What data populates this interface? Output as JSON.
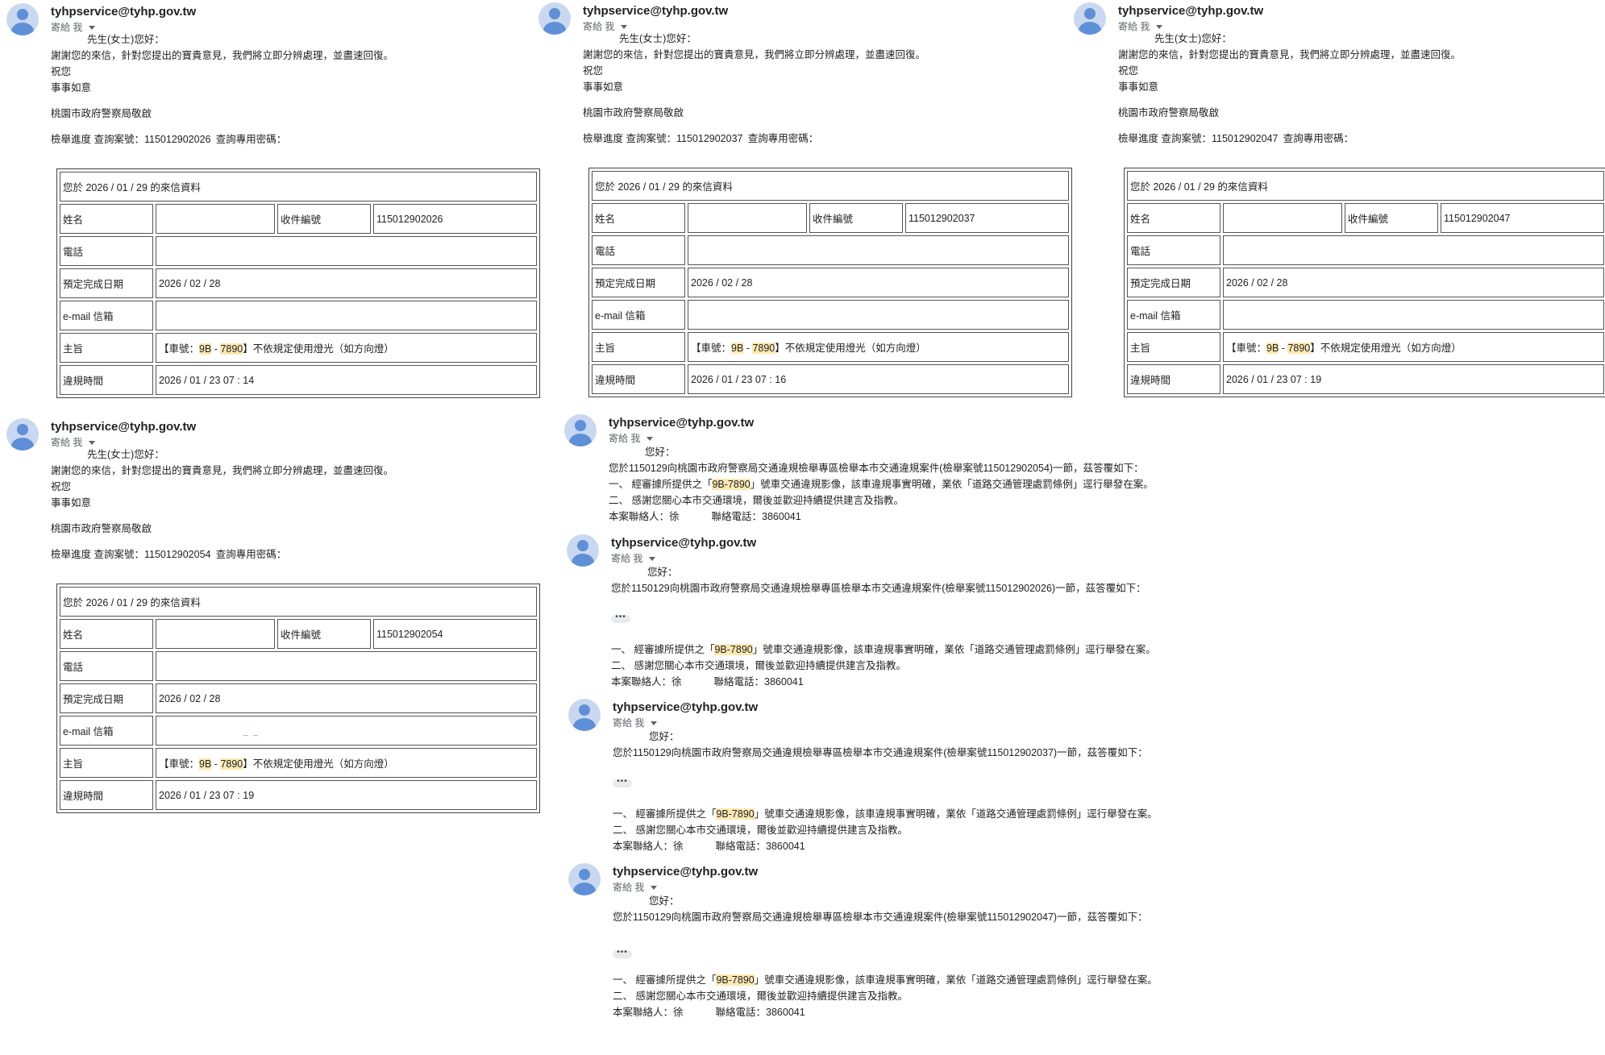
{
  "colors": {
    "highlight": "#fce8b2",
    "avatar_bg": "#c9d8f0",
    "avatar_fg": "#5f8fd6",
    "sender": "#202124",
    "muted": "#5f6368"
  },
  "common": {
    "sender": "tyhpservice@tyhp.gov.tw",
    "to_me": "寄給 我",
    "greeting": "先生(女士)您好：",
    "thanks": "謝謝您的來信，針對您提出的寶貴意見，我們將立即分辨處理，並盡速回復。",
    "wish": "祝您",
    "wish2": "事事如意",
    "sign": "桃園市政府警察局敬啟",
    "progress_prefix": "檢舉進度 查詢案號：",
    "password_label": "查詢專用密碼：",
    "form_title": "您於 2026 / 01 / 29 的來信資料",
    "labels": {
      "name": "姓名",
      "receipt": "收件編號",
      "phone": "電話",
      "due": "預定完成日期",
      "email": "e-mail 信箱",
      "subject": "主旨",
      "time": "違規時間"
    },
    "due_date": "2026 / 02 / 28",
    "subj_pre": "【車號：",
    "plate_a": "9B",
    "plate_sep": "-",
    "plate_b": "7890",
    "subj_post": "】不依規定使用燈光（如方向燈）",
    "hello": "您好：",
    "reply_prefix": "您於1150129向桃園市政府警察局交通違規檢舉專區檢舉本市交通違規案件(檢舉案號",
    "reply_suffix": ")一節，茲答覆如下：",
    "item1_pre": "一、 經審據所提供之「",
    "item1_plate": "9B-7890",
    "item1_post": "」號車交通違規影像，該車違規事實明確，業依「道路交通管理處罰條例」逕行舉發在案。",
    "item2": "二、 感謝您關心本市交通環境，爾後並歡迎持續提供建言及指教。",
    "contact_label": "本案聯絡人：徐",
    "contact_phone": "聯絡電話：3860041",
    "more": "•••",
    "email_mark": "_ _"
  },
  "forms": [
    {
      "case_no": "115012902026",
      "receipt": "115012902026",
      "time": "2026 / 01 / 23 07 : 14"
    },
    {
      "case_no": "115012902037",
      "receipt": "115012902037",
      "time": "2026 / 01 / 23 07 : 16"
    },
    {
      "case_no": "115012902047",
      "receipt": "115012902047",
      "time": "2026 / 01 / 23 07 : 19"
    },
    {
      "case_no": "115012902054",
      "receipt": "115012902054",
      "time": "2026 / 01 / 23 07 : 19"
    }
  ],
  "replies": [
    {
      "case_no": "115012902054"
    },
    {
      "case_no": "115012902026"
    },
    {
      "case_no": "115012902037"
    },
    {
      "case_no": "115012902047"
    }
  ]
}
